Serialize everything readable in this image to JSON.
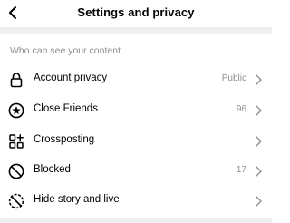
{
  "header": {
    "title": "Settings and privacy",
    "back_icon": "back-arrow-icon"
  },
  "section": {
    "label": "Who can see your content"
  },
  "items": [
    {
      "label": "Account privacy",
      "value": "Public",
      "icon": "lock-icon"
    },
    {
      "label": "Close Friends",
      "value": "96",
      "icon": "star-circle-icon"
    },
    {
      "label": "Crossposting",
      "value": "",
      "icon": "crossposting-icon"
    },
    {
      "label": "Blocked",
      "value": "17",
      "icon": "blocked-icon"
    },
    {
      "label": "Hide story and live",
      "value": "",
      "icon": "hide-story-icon"
    }
  ],
  "colors": {
    "secondary_text": "#8e8e8e",
    "divider": "#efefef"
  }
}
